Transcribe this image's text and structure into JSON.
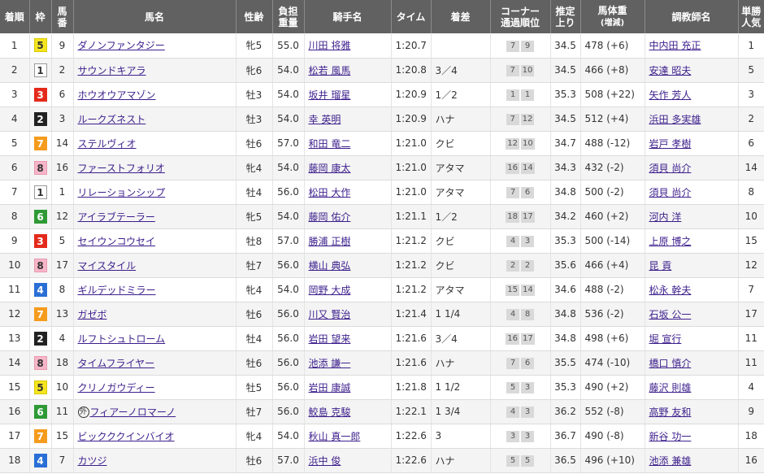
{
  "headers": {
    "rank": "着順",
    "waku": "枠",
    "umaban_1": "馬",
    "umaban_2": "番",
    "horse": "馬名",
    "sex_age": "性齢",
    "weight_1": "負担",
    "weight_2": "重量",
    "jockey": "騎手名",
    "time": "タイム",
    "margin": "着差",
    "corner_1": "コーナー",
    "corner_2": "通過順位",
    "last3f_1": "推定",
    "last3f_2": "上り",
    "body_1": "馬体重",
    "body_2": "(増減)",
    "trainer": "調教師名",
    "odds_1": "単勝",
    "odds_2": "人気"
  },
  "colors": {
    "header_bg": "#616161",
    "link": "#3c1e8c",
    "waku": {
      "1": {
        "bg": "#ffffff",
        "fg": "#333333",
        "border": "#999999"
      },
      "2": {
        "bg": "#222222",
        "fg": "#ffffff",
        "border": "#222222"
      },
      "3": {
        "bg": "#e32a1b",
        "fg": "#ffffff",
        "border": "#e32a1b"
      },
      "4": {
        "bg": "#2a6fd6",
        "fg": "#ffffff",
        "border": "#2a6fd6"
      },
      "5": {
        "bg": "#f5e51f",
        "fg": "#333333",
        "border": "#d9c800"
      },
      "6": {
        "bg": "#2e9a35",
        "fg": "#ffffff",
        "border": "#2e9a35"
      },
      "7": {
        "bg": "#f59b1d",
        "fg": "#ffffff",
        "border": "#f59b1d"
      },
      "8": {
        "bg": "#f7b6c8",
        "fg": "#333333",
        "border": "#e99ab0"
      }
    }
  },
  "rows": [
    {
      "rank": "1",
      "waku": "5",
      "umaban": "9",
      "horse": "ダノンファンタジー",
      "foreign": false,
      "sex_age": "牝5",
      "weight": "55.0",
      "jockey": "川田 将雅",
      "time": "1:20.7",
      "margin": "",
      "corner": [
        "7",
        "9"
      ],
      "last3f": "34.5",
      "body": "478 (+6)",
      "trainer": "中内田 充正",
      "pop": "1"
    },
    {
      "rank": "2",
      "waku": "1",
      "umaban": "2",
      "horse": "サウンドキアラ",
      "foreign": false,
      "sex_age": "牝6",
      "weight": "54.0",
      "jockey": "松若 風馬",
      "time": "1:20.8",
      "margin": "3／4",
      "corner": [
        "7",
        "10"
      ],
      "last3f": "34.5",
      "body": "466 (+8)",
      "trainer": "安達 昭夫",
      "pop": "5"
    },
    {
      "rank": "3",
      "waku": "3",
      "umaban": "6",
      "horse": "ホウオウアマゾン",
      "foreign": false,
      "sex_age": "牡3",
      "weight": "54.0",
      "jockey": "坂井 瑠星",
      "time": "1:20.9",
      "margin": "1／2",
      "corner": [
        "1",
        "1"
      ],
      "last3f": "35.3",
      "body": "508 (+22)",
      "trainer": "矢作 芳人",
      "pop": "3"
    },
    {
      "rank": "4",
      "waku": "2",
      "umaban": "3",
      "horse": "ルークズネスト",
      "foreign": false,
      "sex_age": "牡3",
      "weight": "54.0",
      "jockey": "幸 英明",
      "time": "1:20.9",
      "margin": "ハナ",
      "corner": [
        "7",
        "12"
      ],
      "last3f": "34.5",
      "body": "512 (+4)",
      "trainer": "浜田 多実雄",
      "pop": "2"
    },
    {
      "rank": "5",
      "waku": "7",
      "umaban": "14",
      "horse": "ステルヴィオ",
      "foreign": false,
      "sex_age": "牡6",
      "weight": "57.0",
      "jockey": "和田 竜二",
      "time": "1:21.0",
      "margin": "クビ",
      "corner": [
        "12",
        "10"
      ],
      "last3f": "34.7",
      "body": "488 (-12)",
      "trainer": "岩戸 孝樹",
      "pop": "6"
    },
    {
      "rank": "6",
      "waku": "8",
      "umaban": "16",
      "horse": "ファーストフォリオ",
      "foreign": false,
      "sex_age": "牝4",
      "weight": "54.0",
      "jockey": "藤岡 康太",
      "time": "1:21.0",
      "margin": "アタマ",
      "corner": [
        "16",
        "14"
      ],
      "last3f": "34.3",
      "body": "432 (-2)",
      "trainer": "須貝 尚介",
      "pop": "14"
    },
    {
      "rank": "7",
      "waku": "1",
      "umaban": "1",
      "horse": "リレーションシップ",
      "foreign": false,
      "sex_age": "牡4",
      "weight": "56.0",
      "jockey": "松田 大作",
      "time": "1:21.0",
      "margin": "アタマ",
      "corner": [
        "7",
        "6"
      ],
      "last3f": "34.8",
      "body": "500 (-2)",
      "trainer": "須貝 尚介",
      "pop": "8"
    },
    {
      "rank": "8",
      "waku": "6",
      "umaban": "12",
      "horse": "アイラブテーラー",
      "foreign": false,
      "sex_age": "牝5",
      "weight": "54.0",
      "jockey": "藤岡 佑介",
      "time": "1:21.1",
      "margin": "1／2",
      "corner": [
        "18",
        "17"
      ],
      "last3f": "34.2",
      "body": "460 (+2)",
      "trainer": "河内 洋",
      "pop": "10"
    },
    {
      "rank": "9",
      "waku": "3",
      "umaban": "5",
      "horse": "セイウンコウセイ",
      "foreign": false,
      "sex_age": "牡8",
      "weight": "57.0",
      "jockey": "勝浦 正樹",
      "time": "1:21.2",
      "margin": "クビ",
      "corner": [
        "4",
        "3"
      ],
      "last3f": "35.3",
      "body": "500 (-14)",
      "trainer": "上原 博之",
      "pop": "15"
    },
    {
      "rank": "10",
      "waku": "8",
      "umaban": "17",
      "horse": "マイスタイル",
      "foreign": false,
      "sex_age": "牡7",
      "weight": "56.0",
      "jockey": "横山 典弘",
      "time": "1:21.2",
      "margin": "クビ",
      "corner": [
        "2",
        "2"
      ],
      "last3f": "35.6",
      "body": "466 (+4)",
      "trainer": "昆 貢",
      "pop": "12"
    },
    {
      "rank": "11",
      "waku": "4",
      "umaban": "8",
      "horse": "ギルデッドミラー",
      "foreign": false,
      "sex_age": "牝4",
      "weight": "54.0",
      "jockey": "岡野 大成",
      "time": "1:21.2",
      "margin": "アタマ",
      "corner": [
        "15",
        "14"
      ],
      "last3f": "34.6",
      "body": "488 (-2)",
      "trainer": "松永 幹夫",
      "pop": "7"
    },
    {
      "rank": "12",
      "waku": "7",
      "umaban": "13",
      "horse": "ガゼボ",
      "foreign": false,
      "sex_age": "牡6",
      "weight": "56.0",
      "jockey": "川又 賢治",
      "time": "1:21.4",
      "margin": "1 1/4",
      "corner": [
        "4",
        "8"
      ],
      "last3f": "34.8",
      "body": "536 (-2)",
      "trainer": "石坂 公一",
      "pop": "17"
    },
    {
      "rank": "13",
      "waku": "2",
      "umaban": "4",
      "horse": "ルフトシュトローム",
      "foreign": false,
      "sex_age": "牡4",
      "weight": "56.0",
      "jockey": "岩田 望来",
      "time": "1:21.6",
      "margin": "3／4",
      "corner": [
        "16",
        "17"
      ],
      "last3f": "34.8",
      "body": "498 (+6)",
      "trainer": "堀 宣行",
      "pop": "11"
    },
    {
      "rank": "14",
      "waku": "8",
      "umaban": "18",
      "horse": "タイムフライヤー",
      "foreign": false,
      "sex_age": "牡6",
      "weight": "56.0",
      "jockey": "池添 謙一",
      "time": "1:21.6",
      "margin": "ハナ",
      "corner": [
        "7",
        "6"
      ],
      "last3f": "35.5",
      "body": "474 (-10)",
      "trainer": "橋口 慎介",
      "pop": "11"
    },
    {
      "rank": "15",
      "waku": "5",
      "umaban": "10",
      "horse": "クリノガウディー",
      "foreign": false,
      "sex_age": "牡5",
      "weight": "56.0",
      "jockey": "岩田 康誠",
      "time": "1:21.8",
      "margin": "1 1/2",
      "corner": [
        "5",
        "3"
      ],
      "last3f": "35.3",
      "body": "490 (+2)",
      "trainer": "藤沢 則雄",
      "pop": "4"
    },
    {
      "rank": "16",
      "waku": "6",
      "umaban": "11",
      "horse": "フィアーノロマーノ",
      "foreign": true,
      "foreign_mark": "外",
      "sex_age": "牡7",
      "weight": "56.0",
      "jockey": "鮫島 克駿",
      "time": "1:22.1",
      "margin": "1 3/4",
      "corner": [
        "4",
        "3"
      ],
      "last3f": "36.2",
      "body": "552 (-8)",
      "trainer": "高野 友和",
      "pop": "9"
    },
    {
      "rank": "17",
      "waku": "7",
      "umaban": "15",
      "horse": "ビックククインバイオ",
      "foreign": false,
      "sex_age": "牝4",
      "weight": "54.0",
      "jockey": "秋山 真一郎",
      "time": "1:22.6",
      "margin": "3",
      "corner": [
        "3",
        "3"
      ],
      "last3f": "36.7",
      "body": "490 (-8)",
      "trainer": "新谷 功一",
      "pop": "18"
    },
    {
      "rank": "18",
      "waku": "4",
      "umaban": "7",
      "horse": "カツジ",
      "foreign": false,
      "sex_age": "牡6",
      "weight": "57.0",
      "jockey": "浜中 俊",
      "time": "1:22.6",
      "margin": "ハナ",
      "corner": [
        "5",
        "5"
      ],
      "last3f": "36.5",
      "body": "496 (+10)",
      "trainer": "池添 兼雄",
      "pop": "16"
    }
  ]
}
